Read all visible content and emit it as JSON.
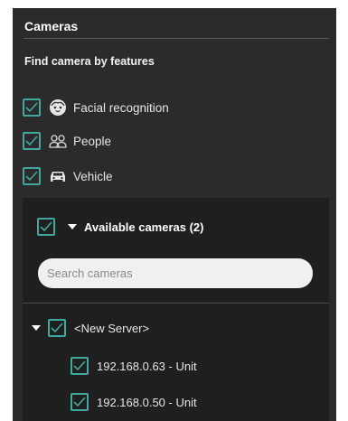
{
  "panel": {
    "title": "Cameras",
    "find_label": "Find camera by features"
  },
  "features": [
    {
      "label": "Facial recognition",
      "icon": "face-icon",
      "checked": true
    },
    {
      "label": "People",
      "icon": "people-icon",
      "checked": true
    },
    {
      "label": "Vehicle",
      "icon": "car-icon",
      "checked": true
    }
  ],
  "cameras": {
    "available_label": "Available cameras (2)",
    "search_placeholder": "Search cameras",
    "server": {
      "label": "<New Server>",
      "checked": true
    },
    "units": [
      {
        "label": "192.168.0.63 - Unit",
        "checked": true
      },
      {
        "label": "192.168.0.50 - Unit",
        "checked": true
      }
    ]
  },
  "colors": {
    "accent": "#3fa9a0",
    "panel_bg": "#2b2b2b",
    "box_bg": "#1f1f1f"
  }
}
